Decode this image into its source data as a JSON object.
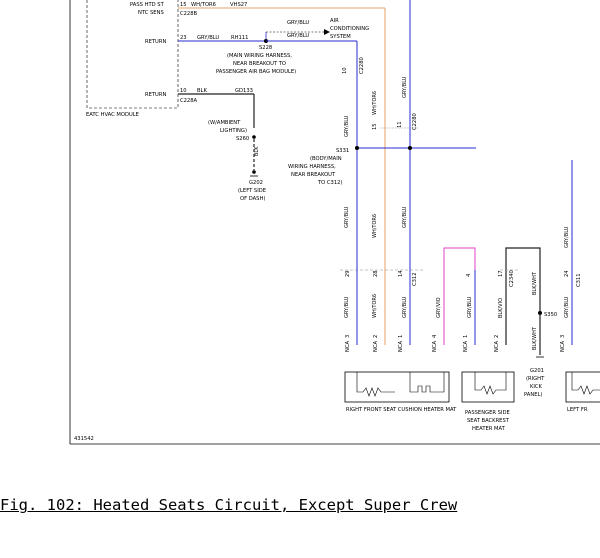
{
  "figure": {
    "caption": "Fig. 102: Heated Seats Circuit, Except Super Crew",
    "code": "431542"
  },
  "module": {
    "name": "EATC HVAC MODULE",
    "rows": [
      {
        "label": "PASS HTD ST",
        "pin": "15",
        "wire": "WH/TOR6",
        "circuit": "VHS27"
      },
      {
        "label": "NTC SENS",
        "connector": "C228B"
      },
      {
        "label": "RETURN",
        "pin": "23",
        "wire": "GRY/BLU",
        "circuit": "RH111"
      },
      {
        "label": "RETURN",
        "pin": "10",
        "wire": "BLK",
        "circuit": "GD133",
        "connector": "C228A"
      }
    ]
  },
  "labels": {
    "ac_wire": "GRY/BLU",
    "ac_target": "AIR CONDITIONING SYSTEM",
    "s228_wire": "GRY/BLU",
    "s228": "S228",
    "s228_desc": "(MAIN WIRING HARNESS, NEAR BREAKOUT TO PASSENGER AIR BAG MODULE)",
    "s260_desc": "(W/AMBIENT LIGHTING)",
    "s260": "S260",
    "blk": "BLK",
    "g202": "G202",
    "g202_desc": "(LEFT SIDE OF DASH)",
    "s331": "S331",
    "s331_desc": "(BODY/MAIN WIRING HARNESS, NEAR BREAKOUT TO C312)",
    "s350": "S350",
    "g201": "G201",
    "g201_desc": "(RIGHT KICK PANEL)",
    "c2280": "C2280",
    "c312": "C312",
    "c2340": "C2340",
    "c311": "C311",
    "c312b": "C312",
    "gry_blu": "GRY/BLU",
    "wh_tor6": "WH/TOR6",
    "gry_vio": "GRY/VIO",
    "blk_wht": "BLK/WHT",
    "nca": "NCA",
    "pin_10": "10",
    "pin_11": "11",
    "pin_15": "15",
    "pin_29": "29",
    "pin_28": "28",
    "pin_14": "14",
    "pin_4": "4",
    "pin_17": "17",
    "pin_24": "24",
    "pin_3": "3",
    "pin_2": "2",
    "pin_1": "1"
  },
  "components": [
    {
      "name": "RIGHT FRONT SEAT CUSHION HEATER MAT"
    },
    {
      "name": "PASSENGER SIDE SEAT BACKREST HEATER MAT"
    },
    {
      "name": "LEFT FRONT SEAT HEATER MAT (PARTIAL)",
      "visible": "LEFT FR"
    }
  ],
  "colors": {
    "orange_wire": "#e8a060",
    "blue_wire": "#2a2ad0",
    "magenta_wire": "#e040c0",
    "dark_wire": "#222222"
  }
}
